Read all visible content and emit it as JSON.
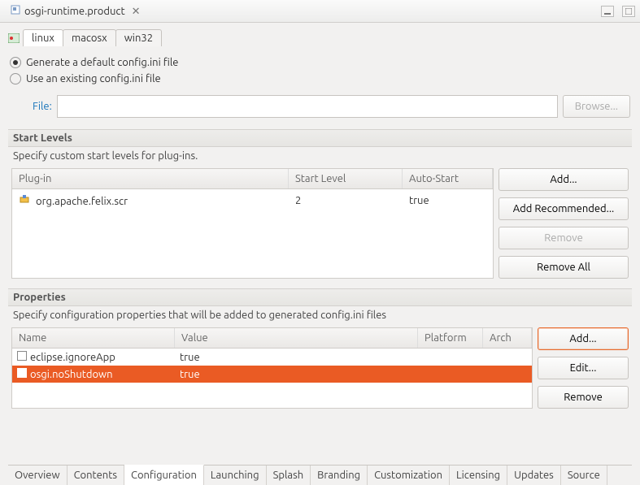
{
  "title": "osgi-runtime.product",
  "os_tabs": [
    "linux",
    "macosx",
    "win32"
  ],
  "os_tab_active": 0,
  "config": {
    "radio_generate": "Generate a default config.ini file",
    "radio_existing": "Use an existing config.ini file",
    "file_label": "File:",
    "file_value": "",
    "browse": "Browse..."
  },
  "start_levels": {
    "title": "Start Levels",
    "desc": "Specify custom start levels for plug-ins.",
    "headers": {
      "plugin": "Plug-in",
      "level": "Start Level",
      "auto": "Auto-Start"
    },
    "rows": [
      {
        "plugin": "org.apache.felix.scr",
        "level": "2",
        "auto": "true"
      }
    ],
    "buttons": {
      "add": "Add...",
      "add_rec": "Add Recommended...",
      "remove": "Remove",
      "remove_all": "Remove All"
    }
  },
  "properties": {
    "title": "Properties",
    "desc": "Specify configuration properties that will be added to generated config.ini files",
    "headers": {
      "name": "Name",
      "value": "Value",
      "platform": "Platform",
      "arch": "Arch"
    },
    "rows": [
      {
        "name": "eclipse.ignoreApp",
        "value": "true",
        "platform": "",
        "arch": "",
        "selected": false
      },
      {
        "name": "osgi.noShutdown",
        "value": "true",
        "platform": "",
        "arch": "",
        "selected": true
      }
    ],
    "buttons": {
      "add": "Add...",
      "edit": "Edit...",
      "remove": "Remove"
    }
  },
  "bottom_tabs": [
    "Overview",
    "Contents",
    "Configuration",
    "Launching",
    "Splash",
    "Branding",
    "Customization",
    "Licensing",
    "Updates",
    "Source"
  ],
  "bottom_tab_active": 2
}
